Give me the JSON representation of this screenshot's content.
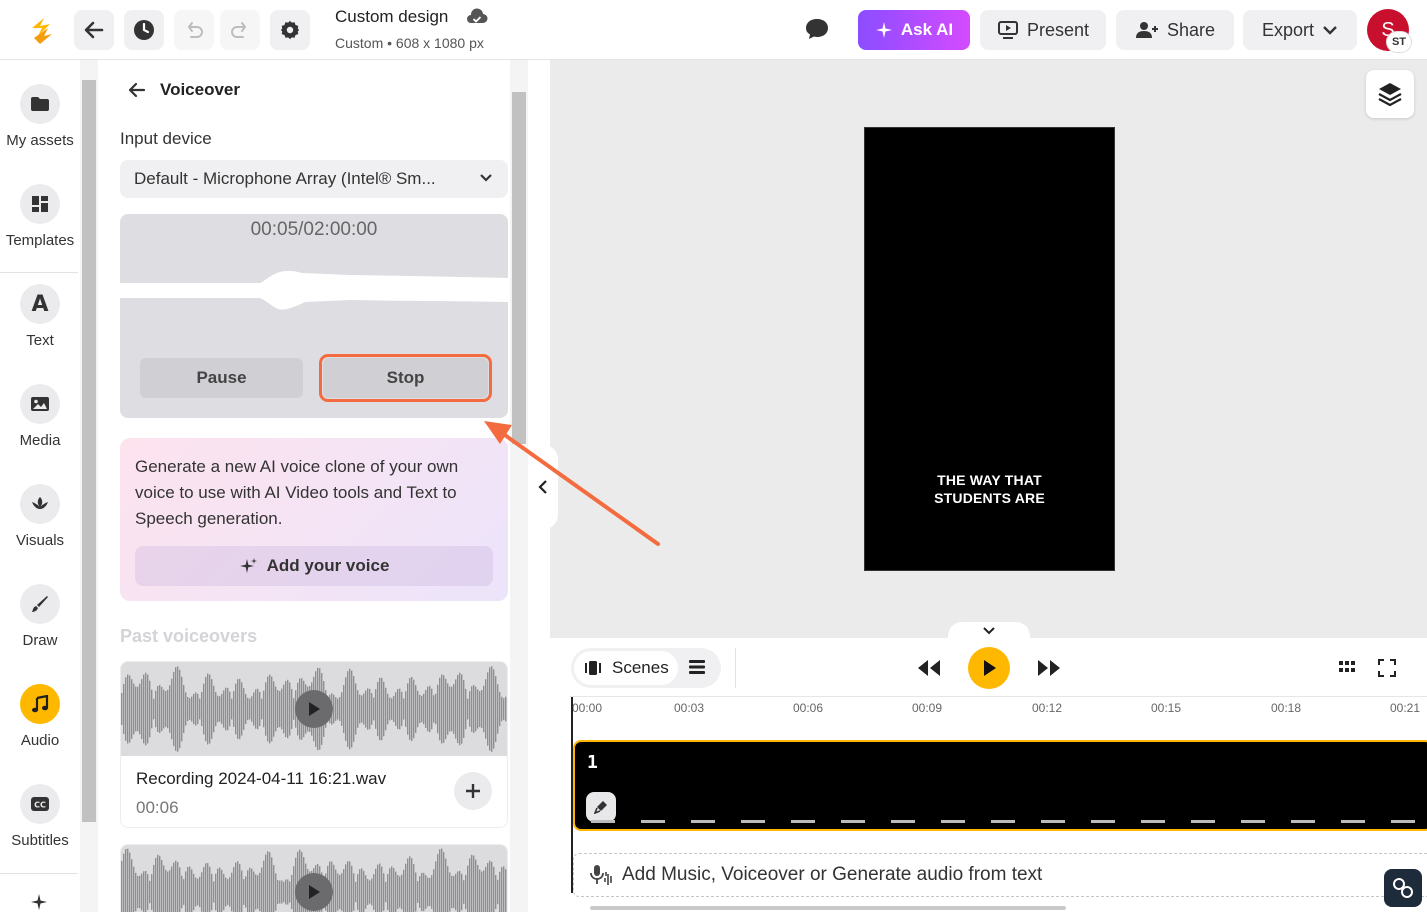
{
  "app": {
    "doc_title": "Custom design",
    "doc_subtitle": "Custom • 608 x 1080 px"
  },
  "toolbar": {
    "ask_ai_label": "Ask AI",
    "present_label": "Present",
    "share_label": "Share",
    "export_label": "Export",
    "avatar_initial": "S",
    "avatar_badge": "ST"
  },
  "rail": {
    "items": [
      {
        "label": "My assets",
        "icon": "folder-icon"
      },
      {
        "label": "Templates",
        "icon": "templates-icon"
      },
      {
        "label": "Text",
        "icon": "text-icon"
      },
      {
        "label": "Media",
        "icon": "image-icon"
      },
      {
        "label": "Visuals",
        "icon": "visuals-icon"
      },
      {
        "label": "Draw",
        "icon": "brush-icon"
      },
      {
        "label": "Audio",
        "icon": "music-icon"
      },
      {
        "label": "Subtitles",
        "icon": "cc-icon"
      }
    ]
  },
  "voiceover": {
    "title": "Voiceover",
    "input_device_label": "Input device",
    "input_device_value": "Default - Microphone Array (Intel® Sm...",
    "recording_time": "00:05/02:00:00",
    "pause_label": "Pause",
    "stop_label": "Stop",
    "ai_promo_text": "Generate a new AI voice clone of your own voice to use with AI Video tools and Text to Speech generation.",
    "add_voice_label": "Add your voice",
    "past_heading": "Past voiceovers",
    "past": [
      {
        "name": "Recording 2024-04-11 16:21.wav",
        "duration": "00:06"
      }
    ]
  },
  "canvas": {
    "artboard_text_line1": "THE WAY THAT",
    "artboard_text_line2": "STUDENTS ARE"
  },
  "timeline": {
    "scenes_label": "Scenes",
    "ticks": [
      "00:00",
      "00:03",
      "00:06",
      "00:09",
      "00:12",
      "00:15",
      "00:18",
      "00:21"
    ],
    "scene_number": "1",
    "audio_prompt": "Add Music, Voiceover or Generate audio from text"
  },
  "colors": {
    "accent": "#ffb800",
    "highlight": "#f36b3f",
    "ai_gradient_start": "#8b4dff",
    "ai_gradient_end": "#d44bff"
  }
}
